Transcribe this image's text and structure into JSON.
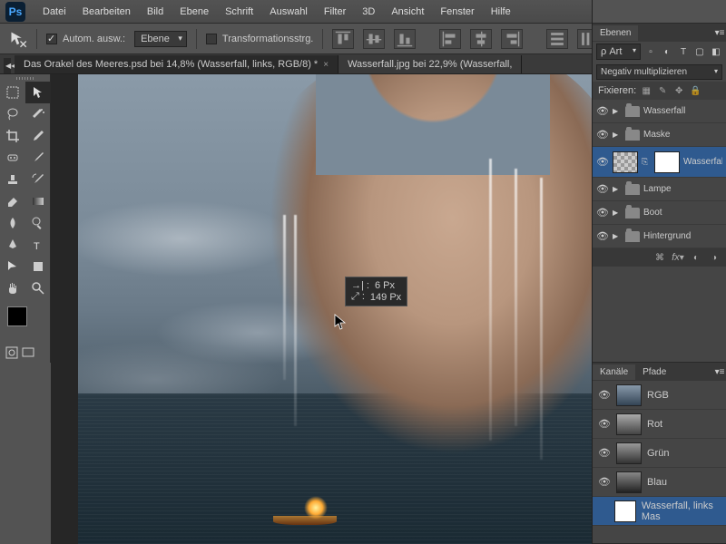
{
  "menu": [
    "Datei",
    "Bearbeiten",
    "Bild",
    "Ebene",
    "Schrift",
    "Auswahl",
    "Filter",
    "3D",
    "Ansicht",
    "Fenster",
    "Hilfe"
  ],
  "options": {
    "auto_select": "Autom. ausw.:",
    "target": "Ebene",
    "transform": "Transformationsstrg."
  },
  "tabs": {
    "a": "Das Orakel des Meeres.psd bei 14,8% (Wasserfall, links, RGB/8) *",
    "b": "Wasserfall.jpg bei 22,9% (Wasserfall,"
  },
  "tooltip": {
    "w_lbl": "→| :",
    "w": "6 Px",
    "h_lbl": "⤢ :",
    "h": "149 Px"
  },
  "panels": {
    "ebenen": "Ebenen",
    "art": "Art",
    "blend": "Negativ multiplizieren",
    "lock_label": "Fixieren:",
    "kanaele": "Kanäle",
    "pfade": "Pfade"
  },
  "layers": [
    {
      "name": "Wasserfall",
      "type": "folder"
    },
    {
      "name": "Maske",
      "type": "folder"
    },
    {
      "name": "Wasserfall",
      "type": "layer",
      "sel": true
    },
    {
      "name": "Lampe",
      "type": "folder"
    },
    {
      "name": "Boot",
      "type": "folder"
    },
    {
      "name": "Hintergrund",
      "type": "folder"
    }
  ],
  "channels": [
    {
      "name": "RGB"
    },
    {
      "name": "Rot"
    },
    {
      "name": "Grün"
    },
    {
      "name": "Blau"
    },
    {
      "name": "Wasserfall, links Mas",
      "mask": true
    }
  ]
}
